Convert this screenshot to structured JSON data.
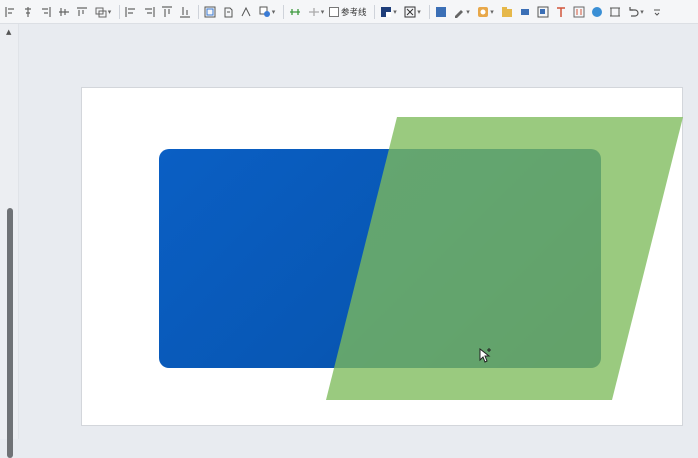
{
  "toolbar": {
    "gridlines_label": "参考线",
    "icons": [
      "align-left-icon",
      "align-center-icon",
      "align-right-icon",
      "align-top-icon",
      "align-middle-icon",
      "group-icon",
      "distribute-horizontal-icon",
      "distribute-vertical-icon",
      "align-edge-top-icon",
      "align-edge-bottom-icon",
      "select-pane-icon",
      "rotate-icon",
      "flip-icon",
      "arrange-icon",
      "move-forward-icon",
      "move-backward-icon",
      "fill-color-icon",
      "text-fill-icon",
      "shape-fill-icon",
      "pen-icon",
      "shape-effect-icon",
      "insert-image-icon",
      "insert-shape-icon",
      "crop-icon",
      "text-box-icon",
      "wordart-icon",
      "circle-shape-icon",
      "frame-icon",
      "undo-icon",
      "more-icon"
    ]
  },
  "slide": {
    "shapes": [
      {
        "name": "rounded-rectangle",
        "fill": "#0a5fc4"
      },
      {
        "name": "parallelogram",
        "fill": "#7dbb5b",
        "opacity": 0.78
      }
    ]
  },
  "colors": {
    "toolbar_bg": "#f5f6f8",
    "workspace_bg": "#e8ebf0",
    "slide_bg": "#ffffff"
  }
}
